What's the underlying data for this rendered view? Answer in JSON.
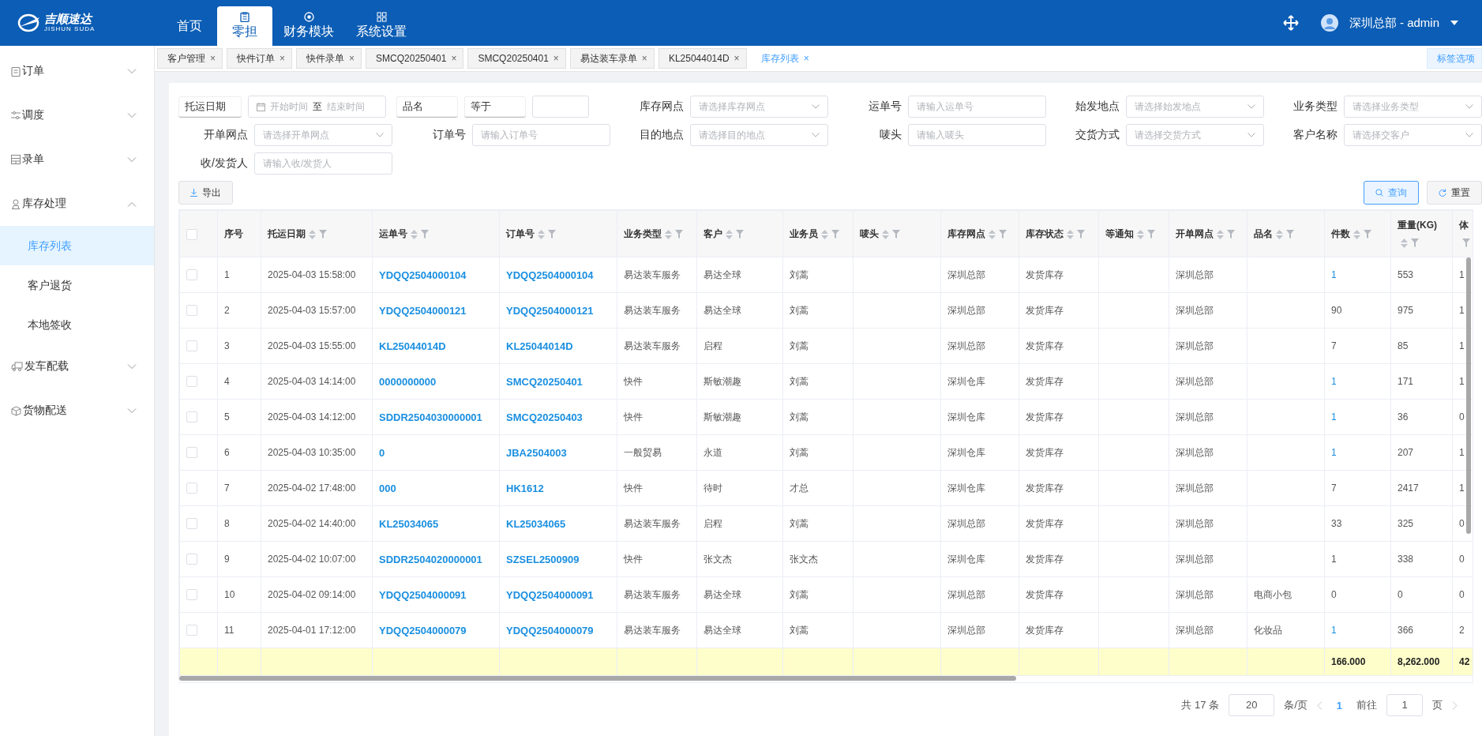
{
  "brand": {
    "name": "吉顺速达",
    "sub": "JISHUN SUDA"
  },
  "nav": [
    {
      "label": "首页",
      "selected": false
    },
    {
      "label": "零担",
      "selected": true
    },
    {
      "label": "财务模块",
      "selected": false
    },
    {
      "label": "系统设置",
      "selected": false
    }
  ],
  "user": {
    "name": "深圳总部 - admin"
  },
  "sidebar": [
    {
      "label": "订单",
      "expanded": false
    },
    {
      "label": "调度",
      "expanded": false
    },
    {
      "label": "录单",
      "expanded": false
    },
    {
      "label": "库存处理",
      "expanded": true,
      "children": [
        {
          "label": "库存列表",
          "selected": true
        },
        {
          "label": "客户退货",
          "selected": false
        },
        {
          "label": "本地签收",
          "selected": false
        }
      ]
    },
    {
      "label": "发车配载",
      "expanded": false
    },
    {
      "label": "货物配送",
      "expanded": false
    }
  ],
  "tabs": [
    {
      "label": "客户管理",
      "close": "×",
      "selected": false
    },
    {
      "label": "快件订单",
      "close": "×",
      "selected": false
    },
    {
      "label": "快件录单",
      "close": "×",
      "selected": false
    },
    {
      "label": "SMCQ20250401",
      "close": "×",
      "selected": false
    },
    {
      "label": "SMCQ20250401",
      "close": "×",
      "selected": false
    },
    {
      "label": "易达装车录单",
      "close": "×",
      "selected": false
    },
    {
      "label": "KL25044014D",
      "close": "×",
      "selected": false
    },
    {
      "label": "库存列表",
      "close": "×",
      "selected": true
    }
  ],
  "tab_options": "标签选项",
  "filters": [
    [
      {
        "kind": "daterange",
        "label": "托运日期",
        "start": "开始时间",
        "sep": "至",
        "end": "结束时间"
      },
      {
        "kind": "compare",
        "label": "品名",
        "operator": "等于"
      },
      {
        "kind": "select",
        "label": "库存网点",
        "placeholder": "请选择库存网点"
      },
      {
        "kind": "input",
        "label": "运单号",
        "placeholder": "请输入运单号"
      },
      {
        "kind": "select",
        "label": "始发地点",
        "placeholder": "请选择始发地点"
      },
      {
        "kind": "select",
        "label": "业务类型",
        "placeholder": "请选择业务类型"
      }
    ],
    [
      {
        "kind": "select",
        "label": "开单网点",
        "placeholder": "请选择开单网点"
      },
      {
        "kind": "input",
        "label": "订单号",
        "placeholder": "请输入订单号"
      },
      {
        "kind": "select",
        "label": "目的地点",
        "placeholder": "请选择目的地点"
      },
      {
        "kind": "input",
        "label": "唛头",
        "placeholder": "请输入唛头"
      },
      {
        "kind": "select",
        "label": "交货方式",
        "placeholder": "请选择交货方式"
      },
      {
        "kind": "select",
        "label": "客户名称",
        "placeholder": "请选择交客户"
      }
    ],
    [
      {
        "kind": "input",
        "label": "收/发货人",
        "placeholder": "请输入收/发货人"
      }
    ]
  ],
  "buttons": {
    "export": "导出",
    "query": "查询",
    "reset": "重置"
  },
  "table": {
    "select_all": {
      "checked": false
    },
    "columns": [
      {
        "label": "序号",
        "kind": "text",
        "sortable": false,
        "filterable": false
      },
      {
        "label": "托运日期",
        "kind": "text",
        "sortable": true,
        "filterable": true
      },
      {
        "label": "运单号",
        "kind": "link",
        "sortable": true,
        "filterable": true
      },
      {
        "label": "订单号",
        "kind": "link",
        "sortable": true,
        "filterable": true
      },
      {
        "label": "业务类型",
        "kind": "text",
        "sortable": true,
        "filterable": true
      },
      {
        "label": "客户",
        "kind": "text",
        "sortable": true,
        "filterable": true
      },
      {
        "label": "业务员",
        "kind": "text",
        "sortable": true,
        "filterable": true
      },
      {
        "label": "唛头",
        "kind": "text",
        "sortable": true,
        "filterable": true
      },
      {
        "label": "库存网点",
        "kind": "text",
        "sortable": true,
        "filterable": true
      },
      {
        "label": "库存状态",
        "kind": "text",
        "sortable": true,
        "filterable": true
      },
      {
        "label": "等通知",
        "kind": "text",
        "sortable": true,
        "filterable": true
      },
      {
        "label": "开单网点",
        "kind": "text",
        "sortable": true,
        "filterable": true
      },
      {
        "label": "品名",
        "kind": "text",
        "sortable": true,
        "filterable": true
      },
      {
        "label": "件数",
        "kind": "qty",
        "sortable": true,
        "filterable": true
      },
      {
        "label": "重量(KG)",
        "kind": "text",
        "sortable": true,
        "filterable": true
      },
      {
        "label": "体",
        "kind": "text",
        "sortable": false,
        "filterable": true
      }
    ],
    "rows": [
      {
        "checked": false,
        "qty_link": true,
        "no": "1",
        "date": "2025-04-03 15:58:00",
        "waybill": "YDQQ2504000104",
        "order": "YDQQ2504000104",
        "type": "易达装车服务",
        "customer": "易达全球",
        "salesman": "刘蒿",
        "depot": "深圳总部",
        "status": "发货库存",
        "branch": "深圳总部",
        "qty": "1",
        "weight": "553",
        "volume": "1"
      },
      {
        "checked": false,
        "qty_link": false,
        "no": "2",
        "date": "2025-04-03 15:57:00",
        "waybill": "YDQQ2504000121",
        "order": "YDQQ2504000121",
        "type": "易达装车服务",
        "customer": "易达全球",
        "salesman": "刘蒿",
        "depot": "深圳总部",
        "status": "发货库存",
        "branch": "深圳总部",
        "qty": "90",
        "weight": "975",
        "volume": "1"
      },
      {
        "checked": false,
        "qty_link": false,
        "no": "3",
        "date": "2025-04-03 15:55:00",
        "waybill": "KL25044014D",
        "order": "KL25044014D",
        "type": "易达装车服务",
        "customer": "启程",
        "salesman": "刘蒿",
        "depot": "深圳总部",
        "status": "发货库存",
        "branch": "深圳总部",
        "qty": "7",
        "weight": "85",
        "volume": "1"
      },
      {
        "checked": false,
        "qty_link": true,
        "no": "4",
        "date": "2025-04-03 14:14:00",
        "waybill": "0000000000",
        "order": "SMCQ20250401",
        "type": "快件",
        "customer": "斯敏潮趣",
        "salesman": "刘蒿",
        "depot": "深圳仓库",
        "status": "发货库存",
        "branch": "深圳总部",
        "qty": "1",
        "weight": "171",
        "volume": "1"
      },
      {
        "checked": false,
        "qty_link": true,
        "no": "5",
        "date": "2025-04-03 14:12:00",
        "waybill": "SDDR2504030000001",
        "order": "SMCQ20250403",
        "type": "快件",
        "customer": "斯敏潮趣",
        "salesman": "刘蒿",
        "depot": "深圳仓库",
        "status": "发货库存",
        "branch": "深圳总部",
        "qty": "1",
        "weight": "36",
        "volume": "0"
      },
      {
        "checked": false,
        "qty_link": true,
        "no": "6",
        "date": "2025-04-03 10:35:00",
        "waybill": "0",
        "order": "JBA2504003",
        "type": "一般贸易",
        "customer": "永道",
        "salesman": "刘蒿",
        "depot": "深圳仓库",
        "status": "发货库存",
        "branch": "深圳总部",
        "qty": "1",
        "weight": "207",
        "volume": "1"
      },
      {
        "checked": false,
        "qty_link": false,
        "no": "7",
        "date": "2025-04-02 17:48:00",
        "waybill": "000",
        "order": "HK1612",
        "type": "快件",
        "customer": "待时",
        "salesman": "才总",
        "depot": "深圳仓库",
        "status": "发货库存",
        "branch": "深圳总部",
        "qty": "7",
        "weight": "2417",
        "volume": "1"
      },
      {
        "checked": false,
        "qty_link": false,
        "no": "8",
        "date": "2025-04-02 14:40:00",
        "waybill": "KL25034065",
        "order": "KL25034065",
        "type": "易达装车服务",
        "customer": "启程",
        "salesman": "刘蒿",
        "depot": "深圳总部",
        "status": "发货库存",
        "branch": "深圳总部",
        "qty": "33",
        "weight": "325",
        "volume": "0"
      },
      {
        "checked": false,
        "qty_link": false,
        "no": "9",
        "date": "2025-04-02 10:07:00",
        "waybill": "SDDR2504020000001",
        "order": "SZSEL2500909",
        "type": "快件",
        "customer": "张文杰",
        "salesman": "张文杰",
        "depot": "深圳仓库",
        "status": "发货库存",
        "branch": "深圳总部",
        "qty": "1",
        "weight": "338",
        "volume": "0"
      },
      {
        "checked": false,
        "qty_link": false,
        "no": "10",
        "date": "2025-04-02 09:14:00",
        "waybill": "YDQQ2504000091",
        "order": "YDQQ2504000091",
        "type": "易达装车服务",
        "customer": "易达全球",
        "salesman": "刘蒿",
        "depot": "深圳总部",
        "status": "发货库存",
        "branch": "深圳总部",
        "product": "电商小包",
        "qty": "0",
        "weight": "0",
        "volume": "0"
      },
      {
        "checked": false,
        "qty_link": true,
        "no": "11",
        "date": "2025-04-01 17:12:00",
        "waybill": "YDQQ2504000079",
        "order": "YDQQ2504000079",
        "type": "易达装车服务",
        "customer": "易达全球",
        "salesman": "刘蒿",
        "depot": "深圳总部",
        "status": "发货库存",
        "branch": "深圳总部",
        "product": "化妆品",
        "qty": "1",
        "weight": "366",
        "volume": "2"
      }
    ],
    "summary": {
      "qty": "166.000",
      "weight": "8,262.000",
      "volume": "42"
    }
  },
  "pagination": {
    "total": "共 17 条",
    "page_size": "20",
    "per_page": "条/页",
    "current": "1",
    "goto": "前往",
    "goto_value": "1",
    "page": "页"
  }
}
